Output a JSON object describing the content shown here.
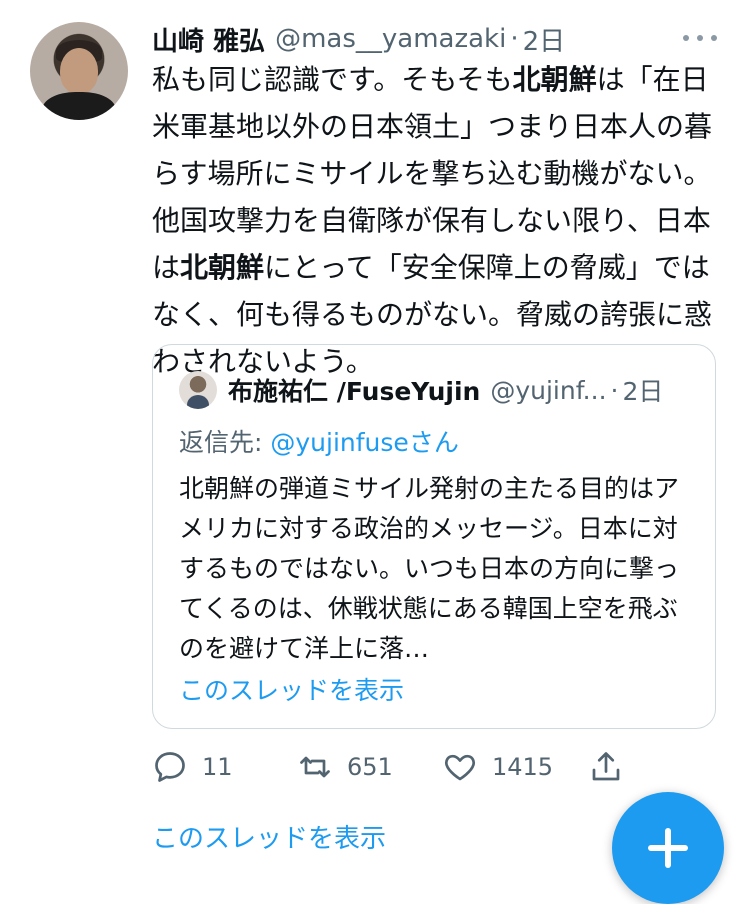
{
  "tweet": {
    "author_name": "山崎 雅弘",
    "handle": "@mas__yamazaki",
    "separator": "·",
    "time": "2日",
    "more_icon": "more-dots-icon",
    "text_segments": [
      {
        "text": "私も同じ認識です。そもそも",
        "bold": false
      },
      {
        "text": "北朝鮮",
        "bold": true
      },
      {
        "text": "は「在日米軍基地以外の日本領土」つまり日本人の暮らす場所にミサイルを撃ち込む動機がない。他国攻撃力を自衛隊が保有しない限り、日本は",
        "bold": false
      },
      {
        "text": "北朝鮮",
        "bold": true
      },
      {
        "text": "にとって「安全保障上の脅威」ではなく、何も得るものがない。脅威の誇張に惑わされないよう。",
        "bold": false
      }
    ]
  },
  "quote": {
    "author_name": "布施祐仁 /FuseYujin",
    "handle": "@yujinf...",
    "separator": "·",
    "time": "2日",
    "reply_prefix": "返信先: ",
    "reply_mention": "@yujinfuse",
    "reply_suffix": "さん",
    "text": "北朝鮮の弾道ミサイル発射の主たる目的はアメリカに対する政治的メッセージ。日本に対するものではない。いつも日本の方向に撃ってくるのは、休戦状態にある韓国上空を飛ぶのを避けて洋上に落…",
    "thread_link": "このスレッドを表示"
  },
  "actions": {
    "reply_count": "11",
    "retweet_count": "651",
    "like_count": "1415"
  },
  "thread_link": "このスレッドを表示",
  "colors": {
    "accent": "#1d9bf0",
    "secondary_text": "#536471",
    "border": "#cfd9de"
  }
}
